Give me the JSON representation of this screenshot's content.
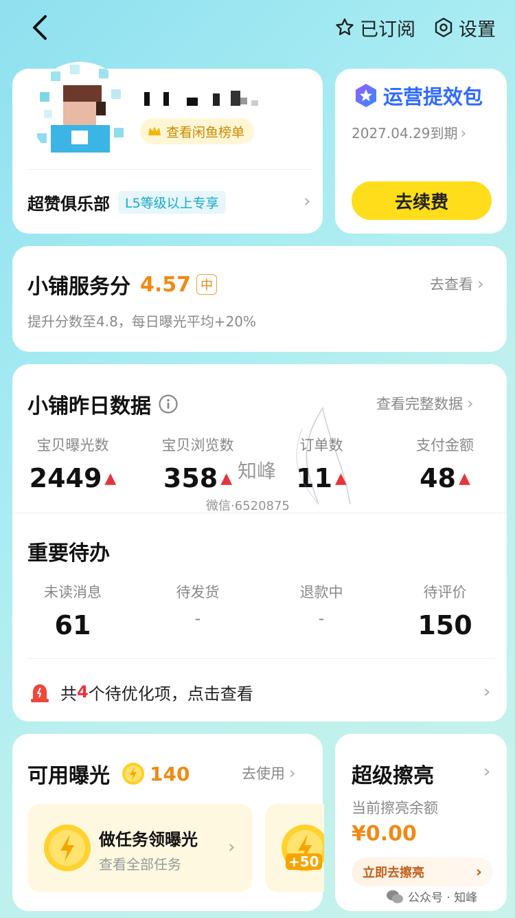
{
  "topbar": {
    "subscribed_label": "已订阅",
    "settings_label": "设置"
  },
  "profile": {
    "rank_chip_label": "查看闲鱼榜单",
    "club_title": "超赞俱乐部",
    "club_tag": "L5等级以上专享"
  },
  "package": {
    "title": "运营提效包",
    "expiry": "2027.04.29到期",
    "renew_label": "去续费"
  },
  "service": {
    "title": "小铺服务分",
    "score": "4.57",
    "level": "中",
    "hint": "提升分数至4.8，每日曝光平均+20%",
    "link_label": "去查看"
  },
  "yesterday": {
    "title": "小铺昨日数据",
    "link_label": "查看完整数据",
    "stats": [
      {
        "label": "宝贝曝光数",
        "value": "2449",
        "trend": "up"
      },
      {
        "label": "宝贝浏览数",
        "value": "358",
        "trend": "up"
      },
      {
        "label": "订单数",
        "value": "11",
        "trend": "up"
      },
      {
        "label": "支付金额",
        "value": "48",
        "trend": "up"
      }
    ]
  },
  "todo": {
    "title": "重要待办",
    "items": [
      {
        "label": "未读消息",
        "value": "61"
      },
      {
        "label": "待发货",
        "value": "-"
      },
      {
        "label": "退款中",
        "value": "-"
      },
      {
        "label": "待评价",
        "value": "150"
      }
    ],
    "alert_prefix": "共",
    "alert_count": "4",
    "alert_suffix": "个待优化项，点击查看"
  },
  "exposure": {
    "title": "可用曝光",
    "count": "140",
    "link_label": "去使用",
    "task_title": "做任务领曝光",
    "task_sub": "查看全部任务",
    "bonus": "+50"
  },
  "shine": {
    "title": "超级擦亮",
    "balance_label": "当前擦亮余额",
    "balance": "¥0.00",
    "button_label": "立即去擦亮"
  },
  "watermark": {
    "overlay_name": "知峰",
    "overlay_wechat": "微信·6520875",
    "footer_account": "公众号 · 知峰"
  },
  "colors": {
    "accent_yellow": "#ffdd1a",
    "score_orange": "#f08a14",
    "trend_red": "#e8333a",
    "package_blue": "#2f6bff"
  }
}
